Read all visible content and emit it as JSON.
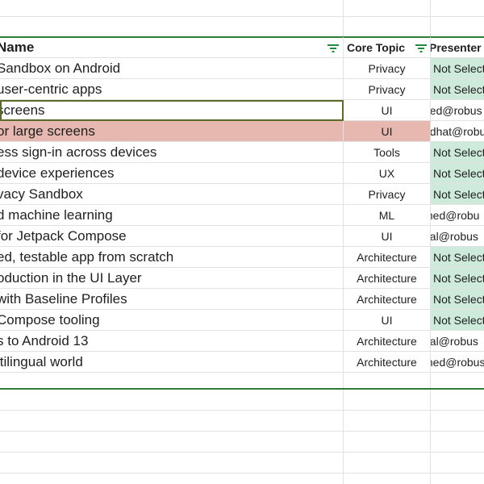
{
  "header": {
    "name": "Name",
    "core_topic": "Core Topic",
    "presenter": "Presenter"
  },
  "rows": [
    {
      "name": "Sandbox on Android",
      "topic": "Privacy",
      "presenter": "Not Selected",
      "status": "not-selected"
    },
    {
      "name": "user-centric apps",
      "topic": "Privacy",
      "presenter": "Not Selected",
      "status": "not-selected"
    },
    {
      "name": "screens",
      "topic": "UI",
      "presenter": "ned@robus",
      "status": "email",
      "selected": true
    },
    {
      "name": "or large screens",
      "topic": "UI",
      "presenter": "edhat@robu",
      "status": "email",
      "highlighted": true
    },
    {
      "name": "ess sign-in across devices",
      "topic": "Tools",
      "presenter": "Not Selected",
      "status": "not-selected"
    },
    {
      "name": "device experiences",
      "topic": "UX",
      "presenter": "Not Selected",
      "status": "not-selected"
    },
    {
      "name": "vacy Sandbox",
      "topic": "Privacy",
      "presenter": "Not Selected",
      "status": "not-selected"
    },
    {
      "name": "d machine learning",
      "topic": "ML",
      "presenter": "med@robu",
      "status": "email"
    },
    {
      "name": "for Jetpack Compose",
      "topic": "UI",
      "presenter": "nal@robus",
      "status": "email"
    },
    {
      "name": "ed, testable app from scratch",
      "topic": "Architecture",
      "presenter": "Not Selected",
      "status": "not-selected"
    },
    {
      "name": "oduction in the UI Layer",
      "topic": "Architecture",
      "presenter": "Not Selected",
      "status": "not-selected"
    },
    {
      "name": "with Baseline Profiles",
      "topic": "Architecture",
      "presenter": "Not Selected",
      "status": "not-selected"
    },
    {
      "name": "Compose tooling",
      "topic": "UI",
      "presenter": "Not Selected",
      "status": "not-selected"
    },
    {
      "name": "s to Android 13",
      "topic": "Architecture",
      "presenter": "nal@robus",
      "status": "email"
    },
    {
      "name": "ltilingual world",
      "topic": "Architecture",
      "presenter": "med@robus",
      "status": "email"
    }
  ],
  "colors": {
    "pill_green": "#cdeadb",
    "highlight_red": "#e6b8af",
    "table_border_green": "#2e7d32",
    "filter_icon": "#1e8e3e",
    "selection_outline": "#5a6b2a"
  }
}
